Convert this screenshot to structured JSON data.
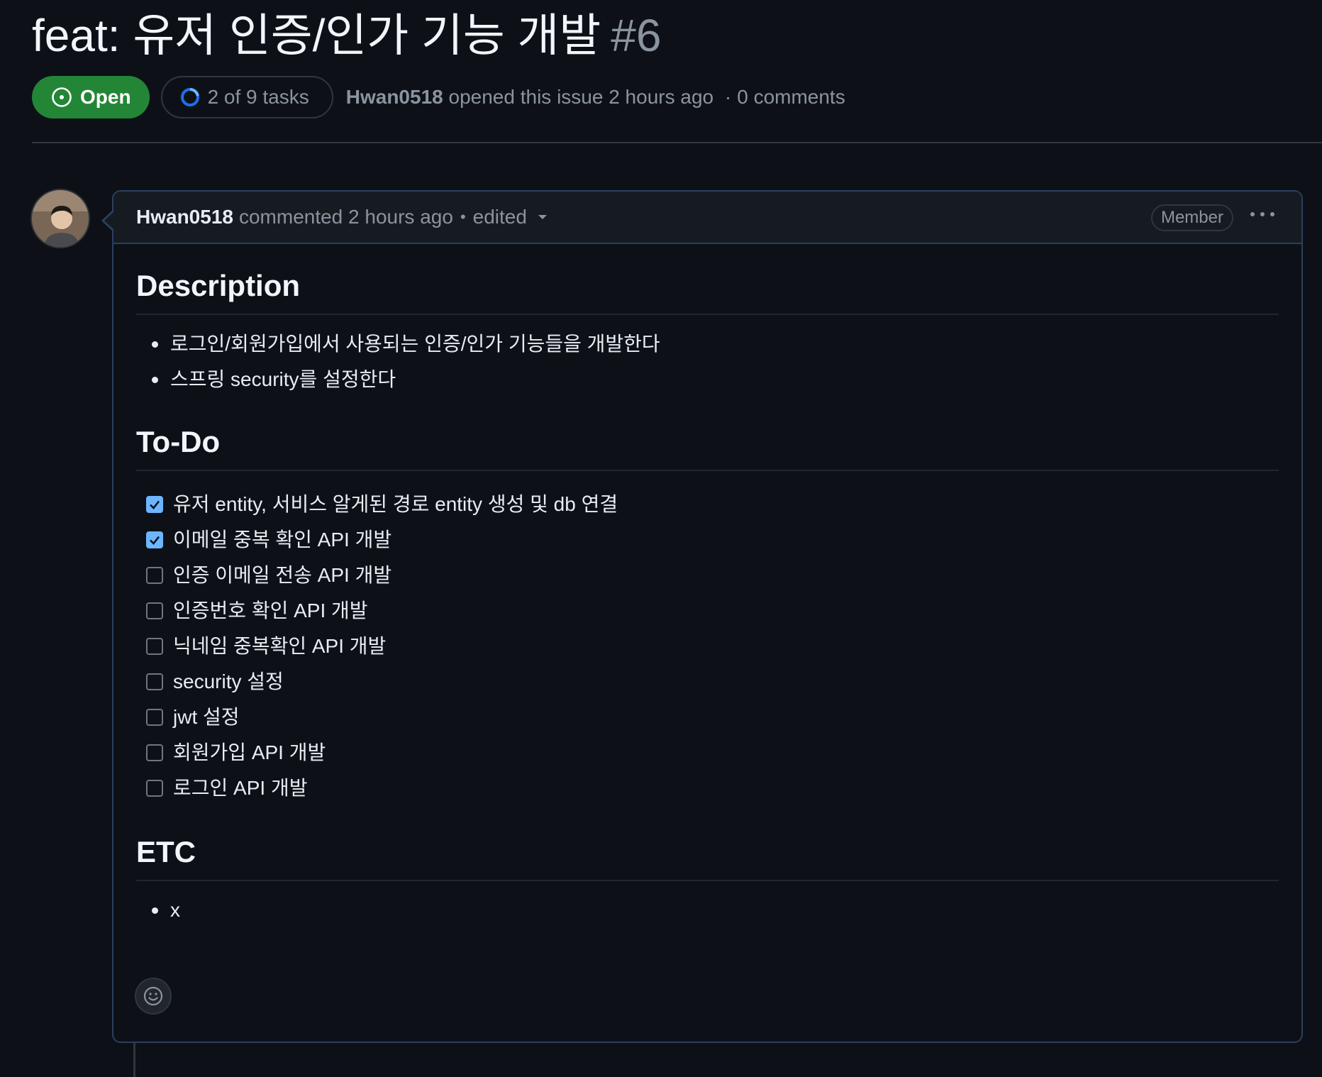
{
  "issue": {
    "title": "feat: 유저 인증/인가 기능 개발",
    "number": "#6",
    "state": "Open",
    "tasks_summary": "2 of 9 tasks",
    "tasks_done": 2,
    "tasks_total": 9,
    "author": "Hwan0518",
    "opened_text": "opened this issue 2 hours ago",
    "separator": "·",
    "comments_count": "0 comments"
  },
  "comment": {
    "author": "Hwan0518",
    "commented_text": "commented 2 hours ago",
    "dot": "•",
    "edited_label": "edited",
    "role_badge": "Member",
    "sections": {
      "description": {
        "heading": "Description",
        "items": [
          "로그인/회원가입에서 사용되는 인증/인가 기능들을 개발한다",
          "스프링 security를 설정한다"
        ]
      },
      "todo": {
        "heading": "To-Do",
        "items": [
          {
            "label": "유저 entity, 서비스 알게된 경로 entity 생성 및 db 연결",
            "checked": true
          },
          {
            "label": "이메일 중복 확인 API 개발",
            "checked": true
          },
          {
            "label": "인증 이메일 전송 API 개발",
            "checked": false
          },
          {
            "label": "인증번호 확인 API 개발",
            "checked": false
          },
          {
            "label": "닉네임 중복확인 API 개발",
            "checked": false
          },
          {
            "label": "security 설정",
            "checked": false
          },
          {
            "label": "jwt 설정",
            "checked": false
          },
          {
            "label": "회원가입 API 개발",
            "checked": false
          },
          {
            "label": "로그인 API 개발",
            "checked": false
          }
        ]
      },
      "etc": {
        "heading": "ETC",
        "items": [
          "x"
        ]
      }
    }
  },
  "colors": {
    "background": "#0d1117",
    "open_green": "#238636",
    "checkbox_checked": "#6cb6ff",
    "muted_text": "#8b949e"
  },
  "icons": {
    "state": "issue-opened-icon",
    "tasks": "progress-ring-icon",
    "caret": "triangle-down-icon",
    "menu": "kebab-horizontal-icon",
    "reaction": "smiley-icon",
    "checkbox": "check-icon"
  }
}
